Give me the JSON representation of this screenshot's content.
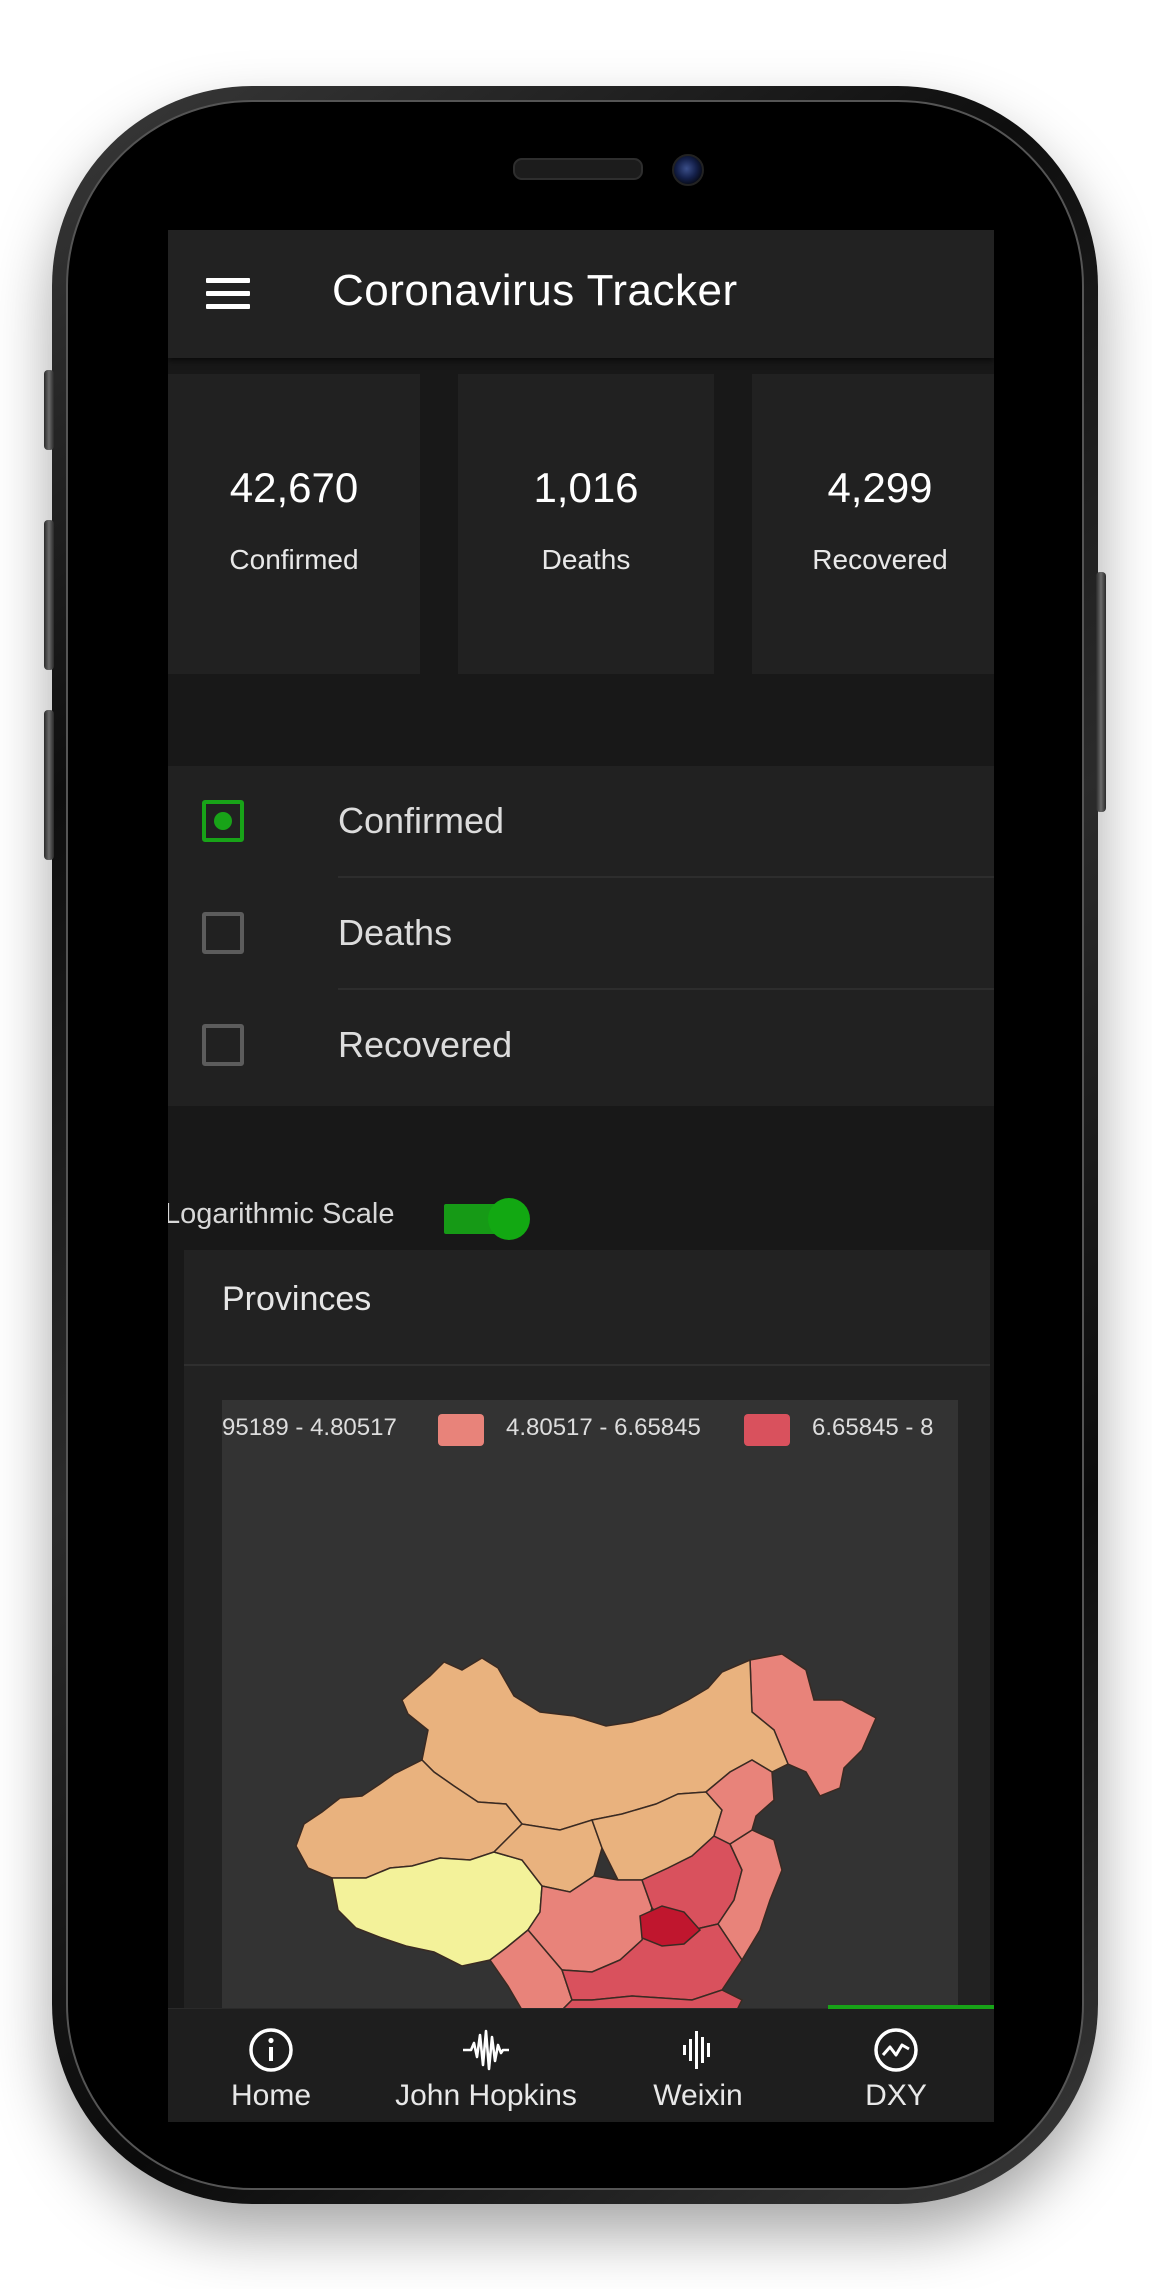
{
  "app_bar": {
    "title": "Coronavirus Tracker",
    "menu_icon": "hamburger-menu-icon"
  },
  "stats": [
    {
      "value": "42,670",
      "label": "Confirmed"
    },
    {
      "value": "1,016",
      "label": "Deaths"
    },
    {
      "value": "4,299",
      "label": "Recovered"
    }
  ],
  "filters": [
    {
      "label": "Confirmed",
      "checked": true
    },
    {
      "label": "Deaths",
      "checked": false
    },
    {
      "label": "Recovered",
      "checked": false
    }
  ],
  "log_scale": {
    "label": "Logarithmic Scale",
    "enabled": true
  },
  "provinces": {
    "title": "Provinces",
    "legend": [
      {
        "range": "95189 - 4.80517",
        "color": ""
      },
      {
        "range": "4.80517 - 6.65845",
        "color": "#e8837a"
      },
      {
        "range": "6.65845 - 8",
        "color": "#d9515d"
      }
    ]
  },
  "bottom_nav": [
    {
      "label": "Home",
      "icon": "info-circle-icon"
    },
    {
      "label": "John Hopkins",
      "icon": "waveform-icon"
    },
    {
      "label": "Weixin",
      "icon": "audio-bars-icon"
    },
    {
      "label": "DXY",
      "icon": "trend-circle-icon",
      "active": true
    }
  ],
  "colors": {
    "accent": "#18a318",
    "background": "#181818",
    "card": "#212121",
    "map_background": "#333333",
    "region_light": "#f3f29a",
    "region_tan": "#e9b27e",
    "region_salmon": "#e8837a",
    "region_red": "#d9515d",
    "region_crimson": "#c0162e"
  }
}
